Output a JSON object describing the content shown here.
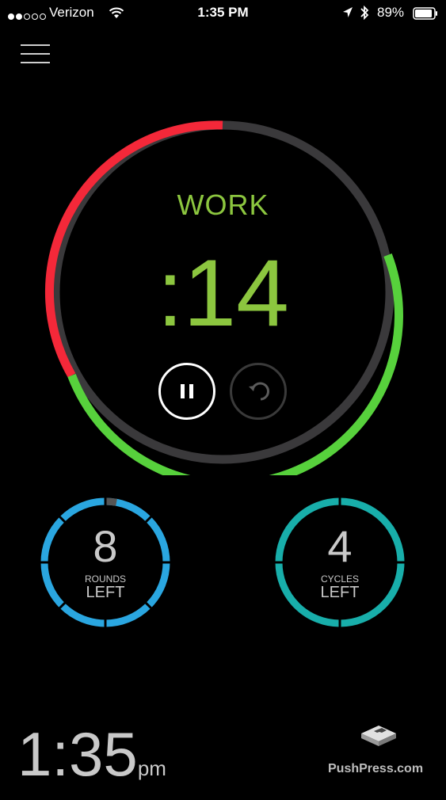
{
  "status_bar": {
    "carrier": "Verizon",
    "time": "1:35 PM",
    "battery": "89%",
    "icons": [
      "signal-dots-icon",
      "wifi-icon",
      "location-arrow-icon",
      "bluetooth-icon",
      "battery-icon"
    ]
  },
  "menu": {
    "icon": "hamburger-menu-icon"
  },
  "timer": {
    "phase": "WORK",
    "countdown": ":14",
    "phase_color": "#8cc63f",
    "ring_colors": {
      "elapsed": "#f42839",
      "remaining": "#57d13c",
      "track": "#3a393b"
    },
    "controls": {
      "pause_icon": "pause-icon",
      "reset_icon": "rotate-back-icon"
    }
  },
  "rounds": {
    "value": "8",
    "line1": "ROUNDS",
    "line2": "LEFT",
    "color": "#2aa6e0"
  },
  "cycles": {
    "value": "4",
    "line1": "CYCLES",
    "line2": "LEFT",
    "color": "#18aeaa"
  },
  "footer": {
    "clock": "1:35",
    "ampm": "pm",
    "brand": "PushPress.com",
    "logo_icon": "pushpress-logo-icon"
  }
}
